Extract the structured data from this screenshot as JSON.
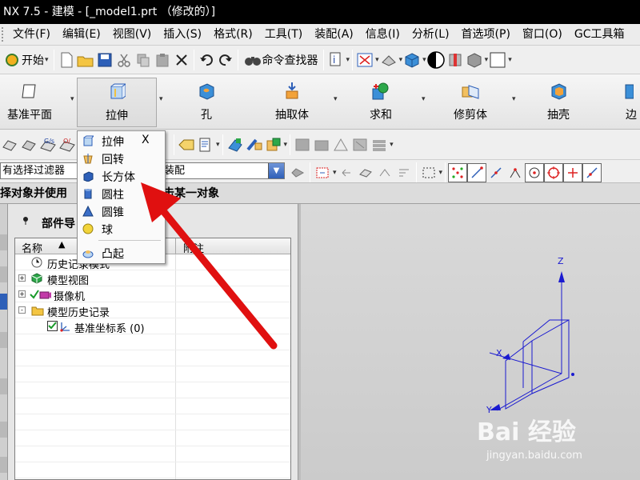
{
  "window": {
    "title": "NX 7.5 - 建模 - [_model1.prt （修改的）]"
  },
  "menubar": {
    "items": [
      "文件(F)",
      "编辑(E)",
      "视图(V)",
      "插入(S)",
      "格式(R)",
      "工具(T)",
      "装配(A)",
      "信息(I)",
      "分析(L)",
      "首选项(P)",
      "窗口(O)",
      "GC工具箱"
    ]
  },
  "toolbar1": {
    "start_label": "开始",
    "command_finder_label": "命令查找器"
  },
  "feature_toolbar": {
    "datum_plane": "基准平面",
    "extrude": "拉伸",
    "hole": "孔",
    "extract_body": "抽取体",
    "unite": "求和",
    "trim_body": "修剪体",
    "shell": "抽壳",
    "edge_blend": "边"
  },
  "filter": {
    "type_filter": "有选择过滤器",
    "scope": "装配"
  },
  "cue_line": {
    "part1": "择对象并使用",
    "part2": "击某一对象"
  },
  "part_navigator": {
    "title": "部件导",
    "columns": {
      "name": "名称",
      "notes": "附注"
    },
    "rows": [
      {
        "label": "历史记录模式",
        "expander": ""
      },
      {
        "label": "模型视图",
        "expander": "+"
      },
      {
        "label": "摄像机",
        "expander": "+"
      },
      {
        "label": "模型历史记录",
        "expander": "-"
      },
      {
        "label": "基准坐标系 (0)",
        "expander": ""
      }
    ]
  },
  "dropdown": {
    "items": [
      {
        "label": "拉伸",
        "key": "X",
        "icon": "extrude-icon"
      },
      {
        "label": "回转",
        "key": "",
        "icon": "revolve-icon"
      },
      {
        "label": "长方体",
        "key": "",
        "icon": "block-icon"
      },
      {
        "label": "圆柱",
        "key": "",
        "icon": "cylinder-icon"
      },
      {
        "label": "圆锥",
        "key": "",
        "icon": "cone-icon"
      },
      {
        "label": "球",
        "key": "",
        "icon": "sphere-icon"
      },
      {
        "label": "凸起",
        "key": "",
        "icon": "emboss-icon"
      }
    ]
  },
  "graphics": {
    "axis_x": "X",
    "axis_y": "Y",
    "axis_z": "Z"
  },
  "watermark": {
    "brand": "Bai 经验",
    "url": "jingyan.baidu.com"
  },
  "colors": {
    "annotation_arrow": "#e01010",
    "csys": "#1a1ad0",
    "title_bg": "#000000"
  }
}
